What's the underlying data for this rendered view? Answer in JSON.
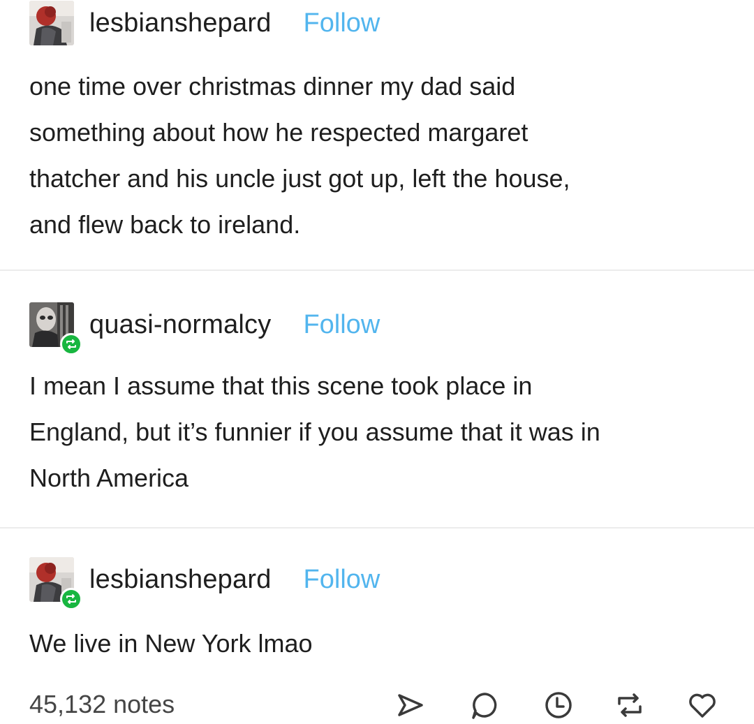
{
  "posts": [
    {
      "username": "lesbianshepard",
      "follow_label": "Follow",
      "reblog": false,
      "lines": [
        "one time over christmas dinner my dad said",
        "something about how he respected margaret",
        "thatcher and his uncle just got up, left the house,",
        "and flew back to ireland."
      ]
    },
    {
      "username": "quasi-normalcy",
      "follow_label": "Follow",
      "reblog": true,
      "lines": [
        "I mean I assume that this scene took place in",
        "England, but it’s funnier if you assume that it was in",
        "North America"
      ]
    },
    {
      "username": "lesbianshepard",
      "follow_label": "Follow",
      "reblog": true,
      "lines": [
        "We live in New York lmao"
      ]
    }
  ],
  "footer": {
    "notes": "45,132 notes",
    "actions": [
      "share-icon",
      "reply-icon",
      "queue-icon",
      "reblog-icon",
      "like-icon"
    ]
  },
  "colors": {
    "follow": "#52b5ee",
    "reblog_badge": "#18b640",
    "text": "#1e1e1e",
    "divider": "#ececec"
  }
}
